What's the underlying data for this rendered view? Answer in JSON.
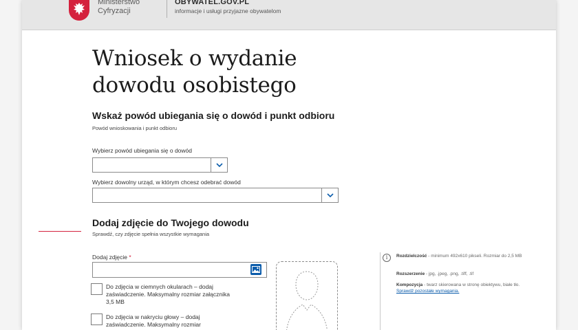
{
  "header": {
    "ministry_line1": "Ministerstwo",
    "ministry_line2": "Cyfryzacji",
    "portal_name": "OBYWATEL.GOV.PL",
    "portal_tagline": "informacje i usługi przyjazne obywatelom"
  },
  "page": {
    "title_line1": "Wniosek o wydanie",
    "title_line2": "dowodu osobistego"
  },
  "section1": {
    "heading": "Wskaż powód ubiegania się o dowód i punkt odbioru",
    "subheading": "Powód wnioskowania i punkt odbioru",
    "reason_label": "Wybierz powód ubiegania się o dowód",
    "reason_value": "",
    "office_label": "Wybierz dowolny urząd, w którym chcesz odebrać dowód",
    "office_value": ""
  },
  "section2": {
    "heading": "Dodaj zdjęcie do Twojego dowodu",
    "subheading": "Sprawdź, czy zdjęcie spełnia wszystkie wymagania",
    "photo_label": "Dodaj zdjęcie",
    "required_mark": "*",
    "checkboxes": [
      {
        "text": "Do zdjęcia w ciemnych okularach – dodaj zaświadczenie. Maksymalny rozmiar załącznika 3,5 MB",
        "checked": false
      },
      {
        "text": "Do zdjęcia w nakryciu głowy – dodaj zaświadczenie. Maksymalny rozmiar",
        "checked": false
      }
    ]
  },
  "requirements": {
    "items": [
      {
        "title": "Rozdzielczość",
        "text": " - minimum 492x610 pikseli. Rozmiar do 2,5 MB"
      },
      {
        "title": "Rozszerzenie",
        "text": " - jpg, .jpeg, .png, .tiff, .tif"
      },
      {
        "title": "Kompozycja",
        "text": " - twarz skierowana w stronę obiektywu, białe tło. ",
        "link": "Sprawdź pozostałe wymagania."
      }
    ]
  },
  "colors": {
    "accent_red": "#d4213d",
    "link_blue": "#0b5cab"
  }
}
